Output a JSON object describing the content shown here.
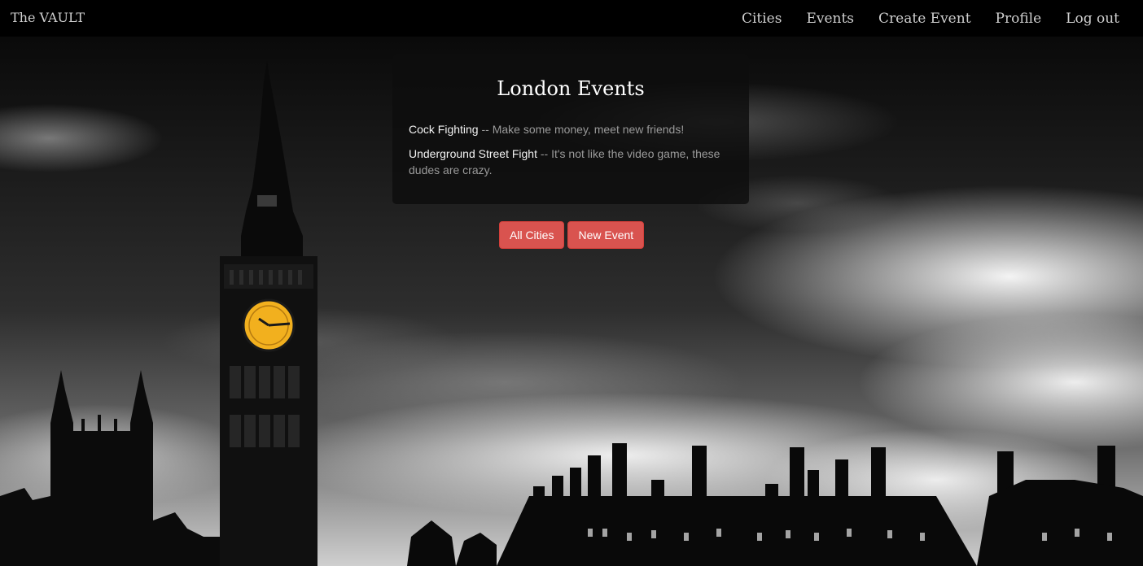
{
  "nav": {
    "brand": "The VAULT",
    "links": [
      "Cities",
      "Events",
      "Create Event",
      "Profile",
      "Log out"
    ]
  },
  "panel": {
    "title": "London Events",
    "events": [
      {
        "name": "Cock Fighting",
        "description": " -- Make some money, meet new friends!"
      },
      {
        "name": "Underground Street Fight",
        "description": " -- It's not like the video game, these dudes are crazy."
      }
    ]
  },
  "buttons": {
    "all_cities": "All Cities",
    "new_event": "New Event"
  },
  "colors": {
    "accent": "#d9534f",
    "navbar": "#000000",
    "clock_face": "#f2b01e"
  },
  "background_image": "black-and-white London skyline with Big Ben (yellow clock face) and Houses of Parliament under stormy clouds"
}
